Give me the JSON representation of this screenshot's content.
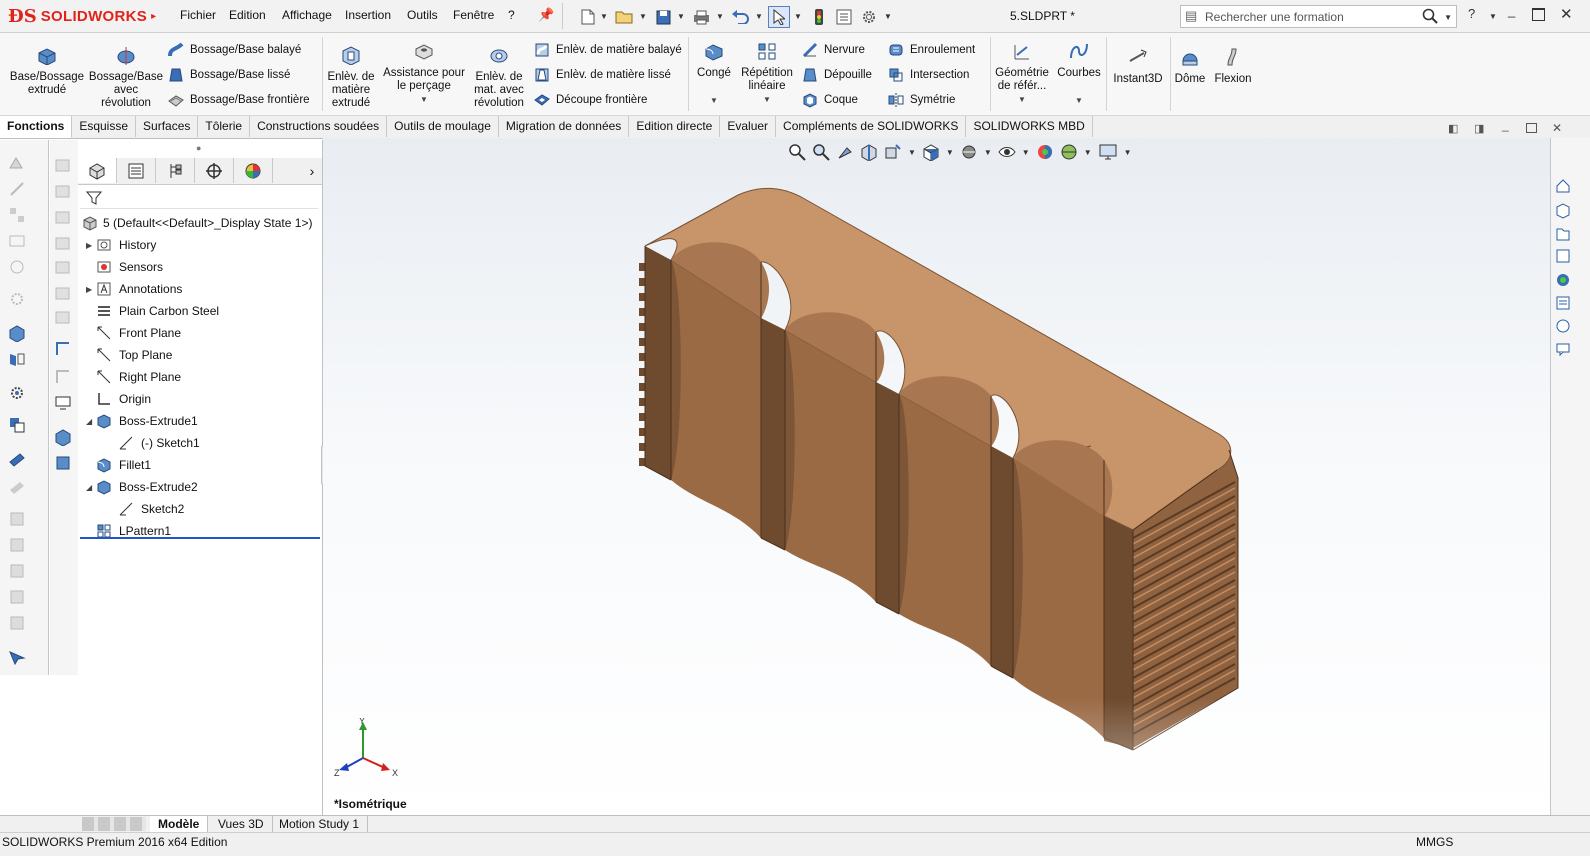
{
  "app": {
    "brand": "SOLIDWORKS",
    "document_title": "5.SLDPRT *"
  },
  "menu": [
    "Fichier",
    "Edition",
    "Affichage",
    "Insertion",
    "Outils",
    "Fenêtre",
    "?"
  ],
  "search": {
    "placeholder": "Rechercher une formation"
  },
  "help_label": "?",
  "command_manager": {
    "base_bossage_extrude": "Base/Bossage extrudé",
    "bossage_revolution": "Bossage/Base avec révolution",
    "bossage_balaye": "Bossage/Base balayé",
    "bossage_lisse": "Bossage/Base lissé",
    "bossage_frontiere": "Bossage/Base frontière",
    "enlev_extrude": "Enlèv. de matière extrudé",
    "assistance_percage": "Assistance pour le perçage",
    "enlev_revolution": "Enlèv. de mat. avec révolution",
    "enlev_balaye": "Enlèv. de matière balayé",
    "enlev_lisse": "Enlèv. de matière lissé",
    "decoupe_frontiere": "Découpe frontière",
    "conge": "Congé",
    "repetition_lineaire": "Répétition linéaire",
    "nervure": "Nervure",
    "depouille": "Dépouille",
    "coque": "Coque",
    "enroulement": "Enroulement",
    "intersection": "Intersection",
    "symetrie": "Symétrie",
    "geometrie_reference": "Géométrie de référ...",
    "courbes": "Courbes",
    "instant3d": "Instant3D",
    "dome": "Dôme",
    "flexion": "Flexion"
  },
  "tabs": [
    "Fonctions",
    "Esquisse",
    "Surfaces",
    "Tôlerie",
    "Constructions soudées",
    "Outils de moulage",
    "Migration de données",
    "Edition directe",
    "Evaluer",
    "Compléments de SOLIDWORKS",
    "SOLIDWORKS MBD"
  ],
  "active_tab": "Fonctions",
  "feature_tree": {
    "root": "5 (Default<<Default>_Display State 1>)",
    "items": [
      {
        "label": "History",
        "expand": "right",
        "indent": 0
      },
      {
        "label": "Sensors",
        "expand": "",
        "indent": 0
      },
      {
        "label": "Annotations",
        "expand": "right",
        "indent": 0
      },
      {
        "label": "Plain Carbon Steel",
        "expand": "",
        "indent": 0
      },
      {
        "label": "Front Plane",
        "expand": "",
        "indent": 0
      },
      {
        "label": "Top Plane",
        "expand": "",
        "indent": 0
      },
      {
        "label": "Right Plane",
        "expand": "",
        "indent": 0
      },
      {
        "label": "Origin",
        "expand": "",
        "indent": 0
      },
      {
        "label": "Boss-Extrude1",
        "expand": "down",
        "indent": 0
      },
      {
        "label": "(-) Sketch1",
        "expand": "",
        "indent": 1
      },
      {
        "label": "Fillet1",
        "expand": "",
        "indent": 0
      },
      {
        "label": "Boss-Extrude2",
        "expand": "down",
        "indent": 0
      },
      {
        "label": "Sketch2",
        "expand": "",
        "indent": 1
      },
      {
        "label": "LPattern1",
        "expand": "",
        "indent": 0
      }
    ]
  },
  "viewport": {
    "view_label": "*Isométrique",
    "triad": {
      "x": "X",
      "y": "Y",
      "z": "Z"
    }
  },
  "bottom_tabs": [
    "Modèle",
    "Vues 3D",
    "Motion Study 1"
  ],
  "status": {
    "left": "SOLIDWORKS Premium 2016 x64 Edition",
    "units": "MMGS"
  },
  "colors": {
    "brand_red": "#e2231a",
    "part_top": "#c8946a",
    "part_side": "#8a5d3b",
    "part_dark": "#6e4a2e",
    "part_inner": "#9a6a45"
  }
}
